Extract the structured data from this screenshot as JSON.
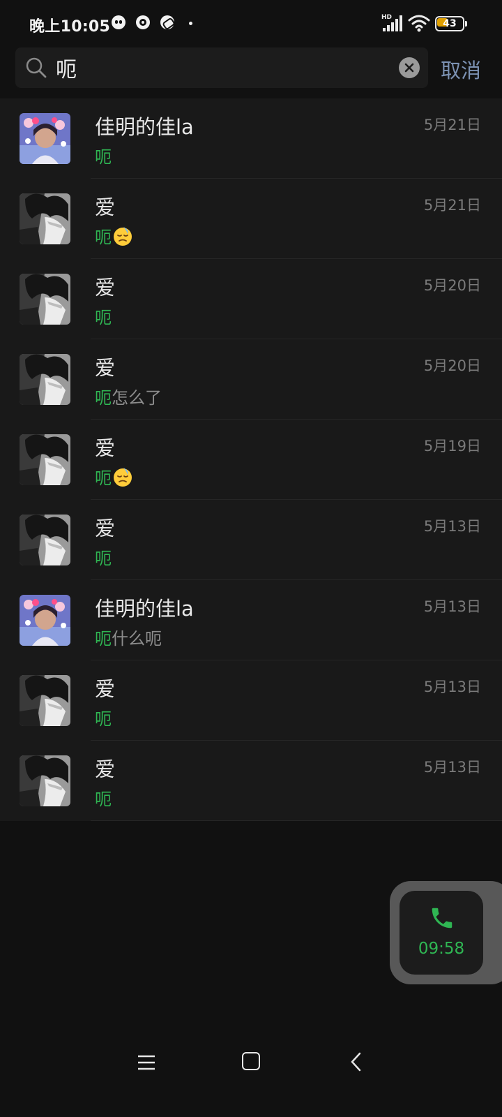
{
  "status_bar": {
    "time": "晚上10:05",
    "network_label": "HD",
    "battery_level": "43",
    "icons": [
      "notification-app-1-icon",
      "notification-app-2-icon",
      "notification-app-3-icon",
      "more-dot-icon",
      "signal-icon",
      "wifi-icon",
      "battery-icon"
    ]
  },
  "search": {
    "query": "呃",
    "clear_icon": "clear-icon",
    "cancel_label": "取消"
  },
  "results": [
    {
      "name": "佳明的佳la",
      "date": "5月21日",
      "highlight": "呃",
      "rest": "",
      "emoji": false,
      "avatar": "girl"
    },
    {
      "name": "爱",
      "date": "5月21日",
      "highlight": "呃",
      "rest": "",
      "emoji": true,
      "avatar": "anime"
    },
    {
      "name": "爱",
      "date": "5月20日",
      "highlight": "呃",
      "rest": "",
      "emoji": false,
      "avatar": "anime"
    },
    {
      "name": "爱",
      "date": "5月20日",
      "highlight": "呃",
      "rest": "怎么了",
      "emoji": false,
      "avatar": "anime"
    },
    {
      "name": "爱",
      "date": "5月19日",
      "highlight": "呃",
      "rest": "",
      "emoji": true,
      "avatar": "anime"
    },
    {
      "name": "爱",
      "date": "5月13日",
      "highlight": "呃",
      "rest": "",
      "emoji": false,
      "avatar": "anime"
    },
    {
      "name": "佳明的佳la",
      "date": "5月13日",
      "highlight": "呃",
      "rest": "什么呃",
      "emoji": false,
      "avatar": "girl"
    },
    {
      "name": "爱",
      "date": "5月13日",
      "highlight": "呃",
      "rest": "",
      "emoji": false,
      "avatar": "anime"
    },
    {
      "name": "爱",
      "date": "5月13日",
      "highlight": "呃",
      "rest": "",
      "emoji": false,
      "avatar": "anime"
    }
  ],
  "call": {
    "timer": "09:58",
    "icon": "phone-icon"
  },
  "colors": {
    "highlight": "#2fb653",
    "cancel": "#7c92b3",
    "background": "#111111",
    "list_background": "#191919"
  }
}
